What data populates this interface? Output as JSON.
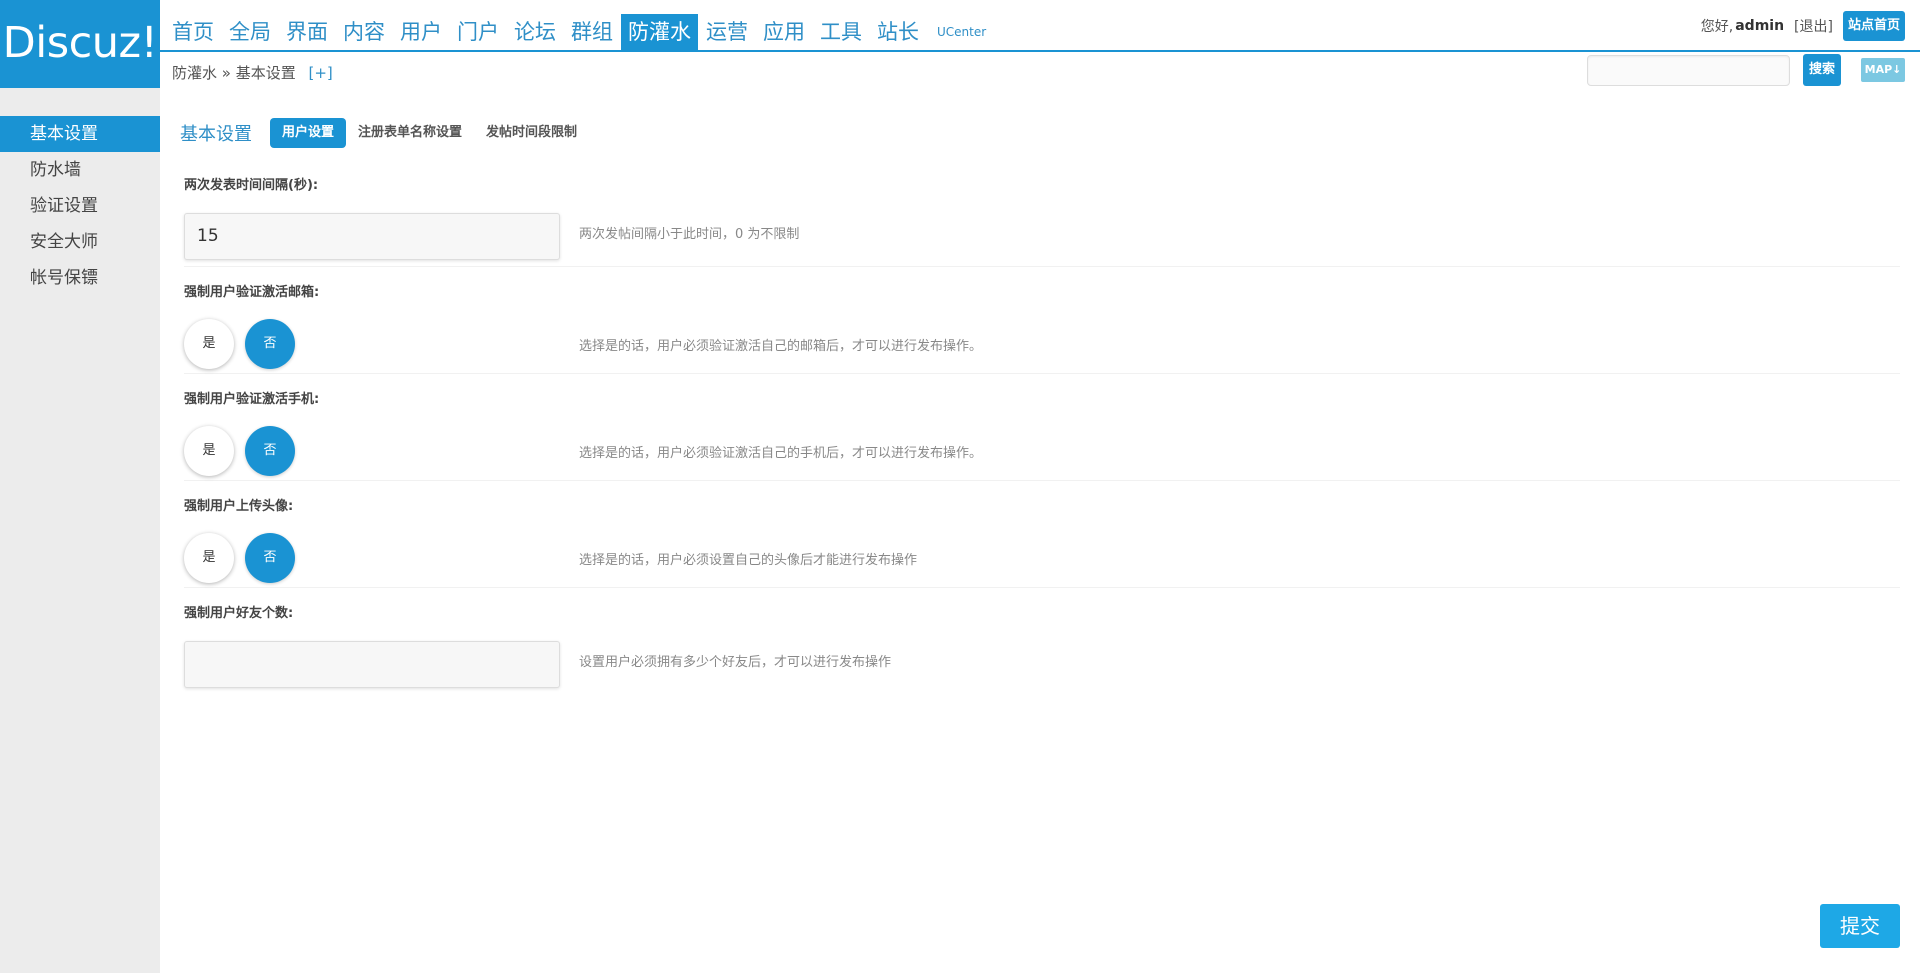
{
  "logo": "Discuz!",
  "nav": {
    "items": [
      "首页",
      "全局",
      "界面",
      "内容",
      "用户",
      "门户",
      "论坛",
      "群组",
      "防灌水",
      "运营",
      "应用",
      "工具",
      "站长"
    ],
    "active_index": 8,
    "ucenter": "UCenter"
  },
  "topbar": {
    "greeting": "您好,",
    "username": "admin",
    "logout": "[退出]",
    "home_button": "站点首页"
  },
  "breadcrumb": {
    "text": "防灌水 » 基本设置",
    "plus": "[+]"
  },
  "search": {
    "placeholder": "",
    "button": "搜索",
    "map_button": "MAP↓"
  },
  "sidebar": {
    "items": [
      "基本设置",
      "防水墙",
      "验证设置",
      "安全大师",
      "帐号保镖"
    ],
    "active_index": 0
  },
  "tabs": {
    "title": "基本设置",
    "items": [
      "用户设置",
      "注册表单名称设置",
      "发帖时间段限制"
    ],
    "active_index": 0
  },
  "form": {
    "rows": [
      {
        "label": "两次发表时间间隔(秒):",
        "type": "input",
        "value": "15",
        "help": "两次发帖间隔小于此时间，0 为不限制"
      },
      {
        "label": "强制用户验证激活邮箱:",
        "type": "radio",
        "yes": "是",
        "no": "否",
        "selected": "否",
        "help": "选择是的话，用户必须验证激活自己的邮箱后，才可以进行发布操作。"
      },
      {
        "label": "强制用户验证激活手机:",
        "type": "radio",
        "yes": "是",
        "no": "否",
        "selected": "否",
        "help": "选择是的话，用户必须验证激活自己的手机后，才可以进行发布操作。"
      },
      {
        "label": "强制用户上传头像:",
        "type": "radio",
        "yes": "是",
        "no": "否",
        "selected": "否",
        "help": "选择是的话，用户必须设置自己的头像后才能进行发布操作"
      },
      {
        "label": "强制用户好友个数:",
        "type": "input",
        "value": "",
        "help": "设置用户必须拥有多少个好友后，才可以进行发布操作"
      }
    ]
  },
  "submit": "提交",
  "colors": {
    "accent": "#1a93d3",
    "sidebar_bg": "#ececec"
  }
}
